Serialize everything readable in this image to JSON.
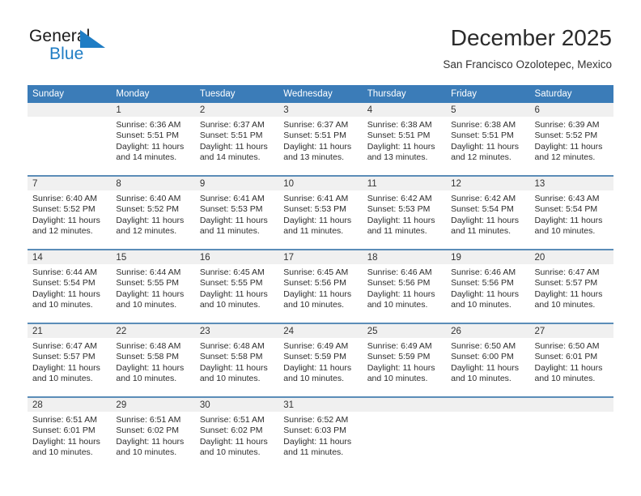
{
  "brand": {
    "name_top": "General",
    "name_bottom": "Blue",
    "triangle_icon": "blue-triangle-icon",
    "top_color": "#1a1a1a",
    "bottom_color": "#1f7dc4"
  },
  "header": {
    "title": "December 2025",
    "subtitle": "San Francisco Ozolotepec, Mexico"
  },
  "theme": {
    "header_bg": "#3b7cb8",
    "header_text": "#ffffff",
    "row_separator": "#5b8db8",
    "daynum_band": "#f0f0f0",
    "cell_bg": "#ffffff",
    "body_text": "#2d2d2d"
  },
  "labels": {
    "sunrise_prefix": "Sunrise:",
    "sunset_prefix": "Sunset:",
    "daylight_prefix": "Daylight:"
  },
  "weekdays": [
    "Sunday",
    "Monday",
    "Tuesday",
    "Wednesday",
    "Thursday",
    "Friday",
    "Saturday"
  ],
  "weeks": [
    [
      {
        "day": "",
        "sunrise": "",
        "sunset": "",
        "daylight_line1": "",
        "daylight_line2": ""
      },
      {
        "day": "1",
        "sunrise": "Sunrise: 6:36 AM",
        "sunset": "Sunset: 5:51 PM",
        "daylight_line1": "Daylight: 11 hours",
        "daylight_line2": "and 14 minutes."
      },
      {
        "day": "2",
        "sunrise": "Sunrise: 6:37 AM",
        "sunset": "Sunset: 5:51 PM",
        "daylight_line1": "Daylight: 11 hours",
        "daylight_line2": "and 14 minutes."
      },
      {
        "day": "3",
        "sunrise": "Sunrise: 6:37 AM",
        "sunset": "Sunset: 5:51 PM",
        "daylight_line1": "Daylight: 11 hours",
        "daylight_line2": "and 13 minutes."
      },
      {
        "day": "4",
        "sunrise": "Sunrise: 6:38 AM",
        "sunset": "Sunset: 5:51 PM",
        "daylight_line1": "Daylight: 11 hours",
        "daylight_line2": "and 13 minutes."
      },
      {
        "day": "5",
        "sunrise": "Sunrise: 6:38 AM",
        "sunset": "Sunset: 5:51 PM",
        "daylight_line1": "Daylight: 11 hours",
        "daylight_line2": "and 12 minutes."
      },
      {
        "day": "6",
        "sunrise": "Sunrise: 6:39 AM",
        "sunset": "Sunset: 5:52 PM",
        "daylight_line1": "Daylight: 11 hours",
        "daylight_line2": "and 12 minutes."
      }
    ],
    [
      {
        "day": "7",
        "sunrise": "Sunrise: 6:40 AM",
        "sunset": "Sunset: 5:52 PM",
        "daylight_line1": "Daylight: 11 hours",
        "daylight_line2": "and 12 minutes."
      },
      {
        "day": "8",
        "sunrise": "Sunrise: 6:40 AM",
        "sunset": "Sunset: 5:52 PM",
        "daylight_line1": "Daylight: 11 hours",
        "daylight_line2": "and 12 minutes."
      },
      {
        "day": "9",
        "sunrise": "Sunrise: 6:41 AM",
        "sunset": "Sunset: 5:53 PM",
        "daylight_line1": "Daylight: 11 hours",
        "daylight_line2": "and 11 minutes."
      },
      {
        "day": "10",
        "sunrise": "Sunrise: 6:41 AM",
        "sunset": "Sunset: 5:53 PM",
        "daylight_line1": "Daylight: 11 hours",
        "daylight_line2": "and 11 minutes."
      },
      {
        "day": "11",
        "sunrise": "Sunrise: 6:42 AM",
        "sunset": "Sunset: 5:53 PM",
        "daylight_line1": "Daylight: 11 hours",
        "daylight_line2": "and 11 minutes."
      },
      {
        "day": "12",
        "sunrise": "Sunrise: 6:42 AM",
        "sunset": "Sunset: 5:54 PM",
        "daylight_line1": "Daylight: 11 hours",
        "daylight_line2": "and 11 minutes."
      },
      {
        "day": "13",
        "sunrise": "Sunrise: 6:43 AM",
        "sunset": "Sunset: 5:54 PM",
        "daylight_line1": "Daylight: 11 hours",
        "daylight_line2": "and 10 minutes."
      }
    ],
    [
      {
        "day": "14",
        "sunrise": "Sunrise: 6:44 AM",
        "sunset": "Sunset: 5:54 PM",
        "daylight_line1": "Daylight: 11 hours",
        "daylight_line2": "and 10 minutes."
      },
      {
        "day": "15",
        "sunrise": "Sunrise: 6:44 AM",
        "sunset": "Sunset: 5:55 PM",
        "daylight_line1": "Daylight: 11 hours",
        "daylight_line2": "and 10 minutes."
      },
      {
        "day": "16",
        "sunrise": "Sunrise: 6:45 AM",
        "sunset": "Sunset: 5:55 PM",
        "daylight_line1": "Daylight: 11 hours",
        "daylight_line2": "and 10 minutes."
      },
      {
        "day": "17",
        "sunrise": "Sunrise: 6:45 AM",
        "sunset": "Sunset: 5:56 PM",
        "daylight_line1": "Daylight: 11 hours",
        "daylight_line2": "and 10 minutes."
      },
      {
        "day": "18",
        "sunrise": "Sunrise: 6:46 AM",
        "sunset": "Sunset: 5:56 PM",
        "daylight_line1": "Daylight: 11 hours",
        "daylight_line2": "and 10 minutes."
      },
      {
        "day": "19",
        "sunrise": "Sunrise: 6:46 AM",
        "sunset": "Sunset: 5:56 PM",
        "daylight_line1": "Daylight: 11 hours",
        "daylight_line2": "and 10 minutes."
      },
      {
        "day": "20",
        "sunrise": "Sunrise: 6:47 AM",
        "sunset": "Sunset: 5:57 PM",
        "daylight_line1": "Daylight: 11 hours",
        "daylight_line2": "and 10 minutes."
      }
    ],
    [
      {
        "day": "21",
        "sunrise": "Sunrise: 6:47 AM",
        "sunset": "Sunset: 5:57 PM",
        "daylight_line1": "Daylight: 11 hours",
        "daylight_line2": "and 10 minutes."
      },
      {
        "day": "22",
        "sunrise": "Sunrise: 6:48 AM",
        "sunset": "Sunset: 5:58 PM",
        "daylight_line1": "Daylight: 11 hours",
        "daylight_line2": "and 10 minutes."
      },
      {
        "day": "23",
        "sunrise": "Sunrise: 6:48 AM",
        "sunset": "Sunset: 5:58 PM",
        "daylight_line1": "Daylight: 11 hours",
        "daylight_line2": "and 10 minutes."
      },
      {
        "day": "24",
        "sunrise": "Sunrise: 6:49 AM",
        "sunset": "Sunset: 5:59 PM",
        "daylight_line1": "Daylight: 11 hours",
        "daylight_line2": "and 10 minutes."
      },
      {
        "day": "25",
        "sunrise": "Sunrise: 6:49 AM",
        "sunset": "Sunset: 5:59 PM",
        "daylight_line1": "Daylight: 11 hours",
        "daylight_line2": "and 10 minutes."
      },
      {
        "day": "26",
        "sunrise": "Sunrise: 6:50 AM",
        "sunset": "Sunset: 6:00 PM",
        "daylight_line1": "Daylight: 11 hours",
        "daylight_line2": "and 10 minutes."
      },
      {
        "day": "27",
        "sunrise": "Sunrise: 6:50 AM",
        "sunset": "Sunset: 6:01 PM",
        "daylight_line1": "Daylight: 11 hours",
        "daylight_line2": "and 10 minutes."
      }
    ],
    [
      {
        "day": "28",
        "sunrise": "Sunrise: 6:51 AM",
        "sunset": "Sunset: 6:01 PM",
        "daylight_line1": "Daylight: 11 hours",
        "daylight_line2": "and 10 minutes."
      },
      {
        "day": "29",
        "sunrise": "Sunrise: 6:51 AM",
        "sunset": "Sunset: 6:02 PM",
        "daylight_line1": "Daylight: 11 hours",
        "daylight_line2": "and 10 minutes."
      },
      {
        "day": "30",
        "sunrise": "Sunrise: 6:51 AM",
        "sunset": "Sunset: 6:02 PM",
        "daylight_line1": "Daylight: 11 hours",
        "daylight_line2": "and 10 minutes."
      },
      {
        "day": "31",
        "sunrise": "Sunrise: 6:52 AM",
        "sunset": "Sunset: 6:03 PM",
        "daylight_line1": "Daylight: 11 hours",
        "daylight_line2": "and 11 minutes."
      },
      {
        "day": "",
        "sunrise": "",
        "sunset": "",
        "daylight_line1": "",
        "daylight_line2": ""
      },
      {
        "day": "",
        "sunrise": "",
        "sunset": "",
        "daylight_line1": "",
        "daylight_line2": ""
      },
      {
        "day": "",
        "sunrise": "",
        "sunset": "",
        "daylight_line1": "",
        "daylight_line2": ""
      }
    ]
  ]
}
